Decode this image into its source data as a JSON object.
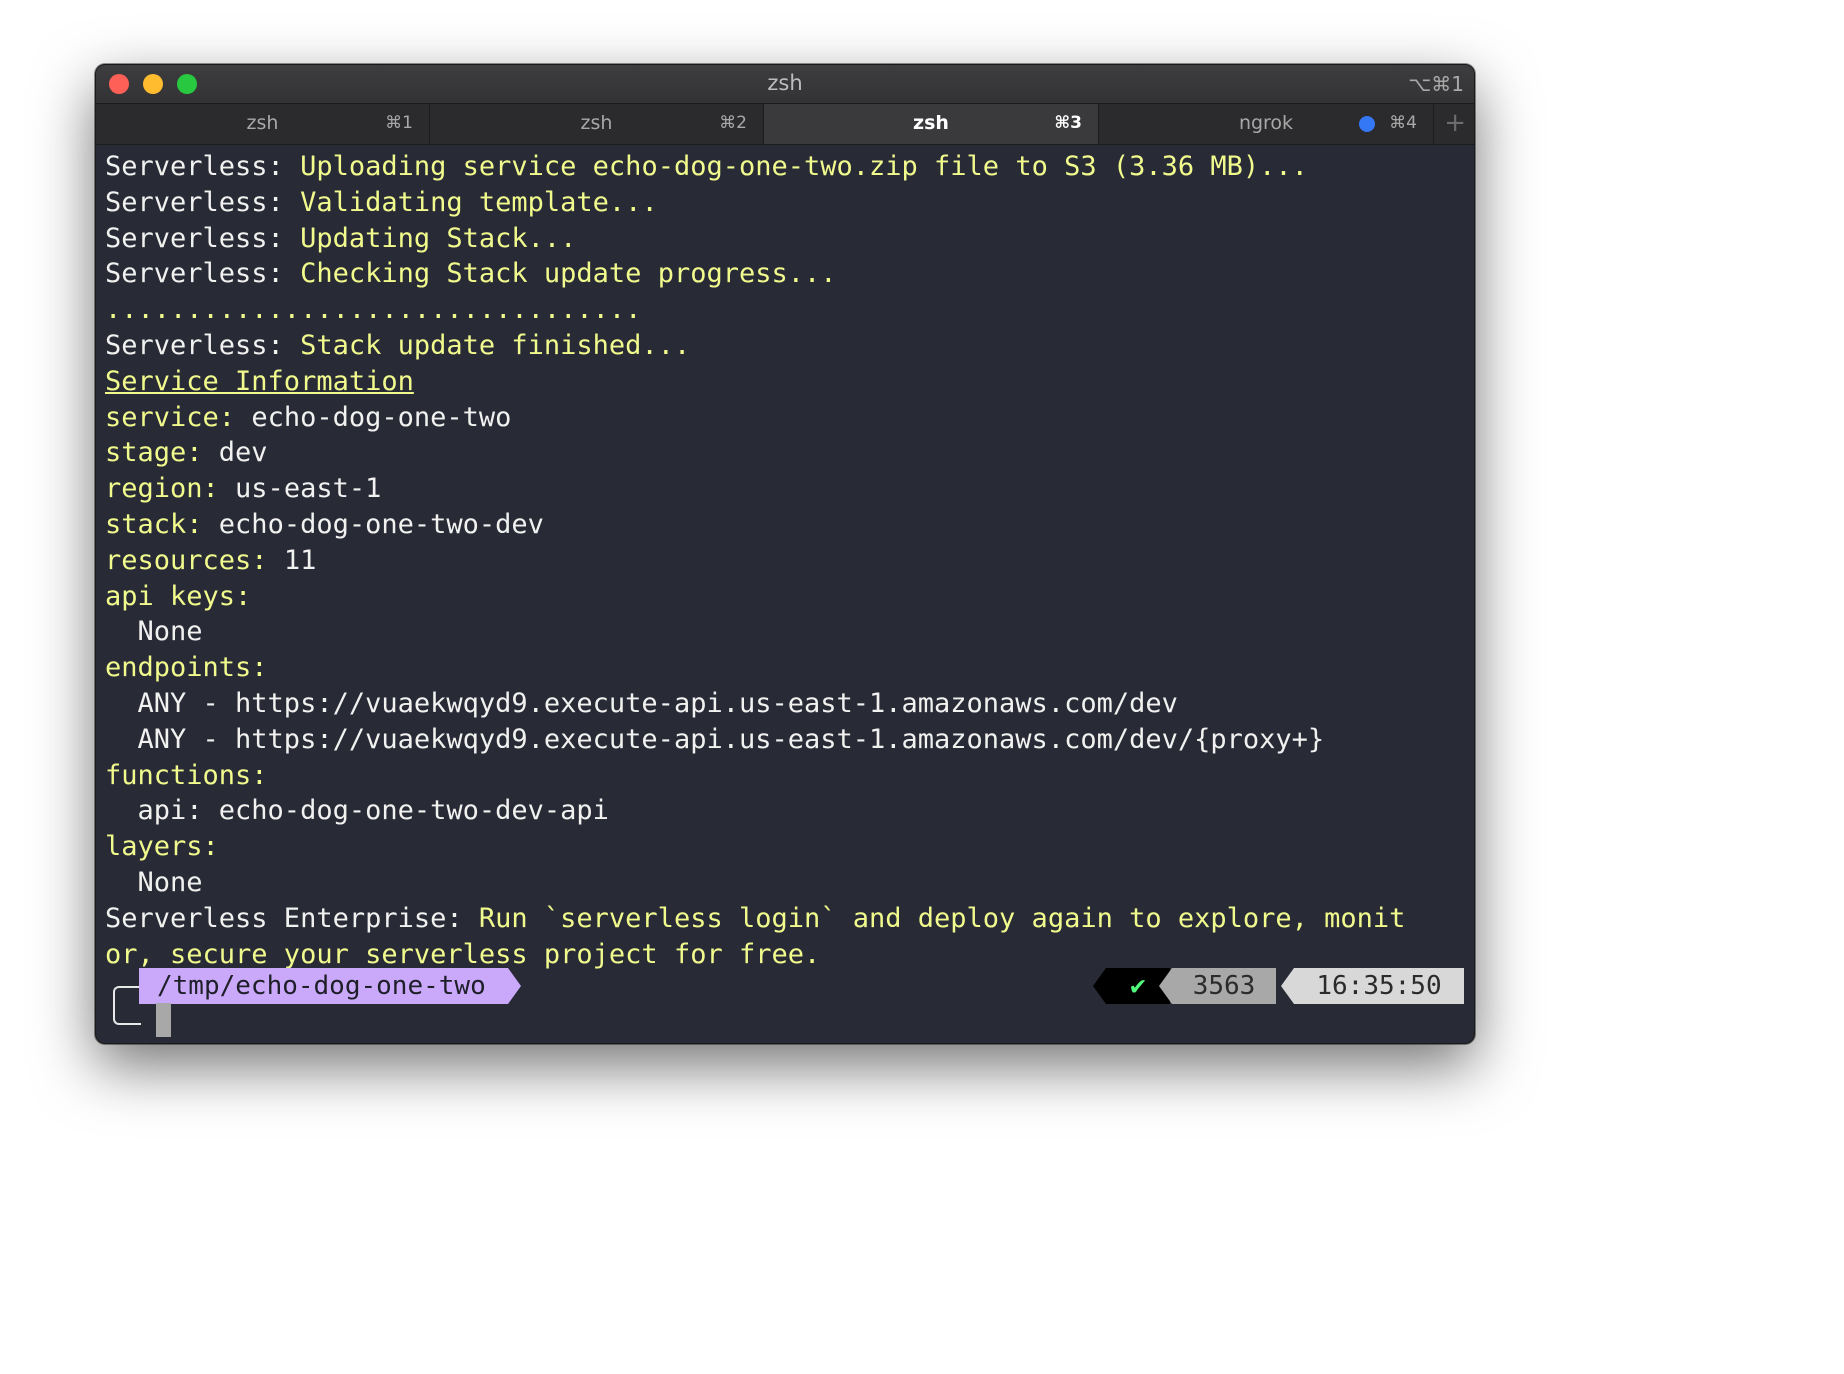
{
  "window": {
    "title": "zsh",
    "shortcut": "⌥⌘1"
  },
  "tabs": [
    {
      "label": "zsh",
      "key": "⌘1"
    },
    {
      "label": "zsh",
      "key": "⌘2"
    },
    {
      "label": "zsh",
      "key": "⌘3"
    },
    {
      "label": "ngrok",
      "key": "⌘4"
    }
  ],
  "active_tab": "zsh ⌘3",
  "colors": {
    "background": "#282a36",
    "keyword": "#f1fa8c",
    "text": "#f1f1f0",
    "prompt_path_bg": "#caa9fa",
    "status_ok": "#50fa7b",
    "ngrok_dot": "#3478f6"
  },
  "output": [
    {
      "pre": "Serverless: ",
      "hl": "Uploading service echo-dog-one-two.zip file to S3 (3.36 MB)...",
      "post": ""
    },
    {
      "pre": "Serverless: ",
      "hl": "Validating template...",
      "post": ""
    },
    {
      "pre": "Serverless: ",
      "hl": "Updating Stack...",
      "post": ""
    },
    {
      "pre": "Serverless: ",
      "hl": "Checking Stack update progress...",
      "post": ""
    },
    {
      "pre": "",
      "hl": ".................................",
      "post": ""
    },
    {
      "pre": "Serverless: ",
      "hl": "Stack update finished...",
      "post": ""
    },
    {
      "pre": "",
      "hl": "",
      "post": "",
      "underline": "Service Information"
    },
    {
      "pre": "",
      "hl": "service: ",
      "post": "echo-dog-one-two"
    },
    {
      "pre": "",
      "hl": "stage: ",
      "post": "dev"
    },
    {
      "pre": "",
      "hl": "region: ",
      "post": "us-east-1"
    },
    {
      "pre": "",
      "hl": "stack: ",
      "post": "echo-dog-one-two-dev"
    },
    {
      "pre": "",
      "hl": "resources: ",
      "post": "11"
    },
    {
      "pre": "",
      "hl": "api keys:",
      "post": ""
    },
    {
      "pre": "  None",
      "hl": "",
      "post": ""
    },
    {
      "pre": "",
      "hl": "endpoints:",
      "post": ""
    },
    {
      "pre": "  ANY - https://vuaekwqyd9.execute-api.us-east-1.amazonaws.com/dev",
      "hl": "",
      "post": ""
    },
    {
      "pre": "  ANY - https://vuaekwqyd9.execute-api.us-east-1.amazonaws.com/dev/{proxy+}",
      "hl": "",
      "post": ""
    },
    {
      "pre": "",
      "hl": "functions:",
      "post": ""
    },
    {
      "pre": "  api: echo-dog-one-two-dev-api",
      "hl": "",
      "post": ""
    },
    {
      "pre": "",
      "hl": "layers:",
      "post": ""
    },
    {
      "pre": "  None",
      "hl": "",
      "post": ""
    },
    {
      "pre": "Serverless Enterprise: ",
      "hl": "Run `serverless login` and deploy again to explore, monit",
      "post": ""
    },
    {
      "pre": "",
      "hl": "or, secure your serverless project for free.",
      "post": ""
    }
  ],
  "prompt": {
    "path": "/tmp/echo-dog-one-two",
    "status": "✔",
    "history": "3563",
    "time": "16:35:50"
  }
}
